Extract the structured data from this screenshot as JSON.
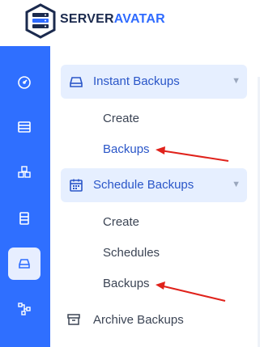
{
  "brand": {
    "name_part1": "SERVER",
    "name_part2": "AVATAR",
    "accent_color": "#2f6fff",
    "logo_icon": "server-stack-logo"
  },
  "rail": {
    "items": [
      {
        "icon": "dashboard-gauge-icon",
        "active": false
      },
      {
        "icon": "server-list-icon",
        "active": false
      },
      {
        "icon": "cubes-icon",
        "active": false
      },
      {
        "icon": "database-icon",
        "active": false
      },
      {
        "icon": "hard-drive-icon",
        "active": true
      },
      {
        "icon": "network-nodes-icon",
        "active": false
      }
    ]
  },
  "menu": {
    "instant": {
      "label": "Instant Backups",
      "icon": "hard-drive-icon",
      "items": [
        "Create",
        "Backups"
      ],
      "active_item": "Backups"
    },
    "schedule": {
      "label": "Schedule Backups",
      "icon": "calendar-icon",
      "items": [
        "Create",
        "Schedules",
        "Backups"
      ]
    },
    "archive": {
      "label": "Archive Backups",
      "icon": "archive-box-icon"
    }
  },
  "annotations": {
    "arrow_color": "#e0221b"
  }
}
